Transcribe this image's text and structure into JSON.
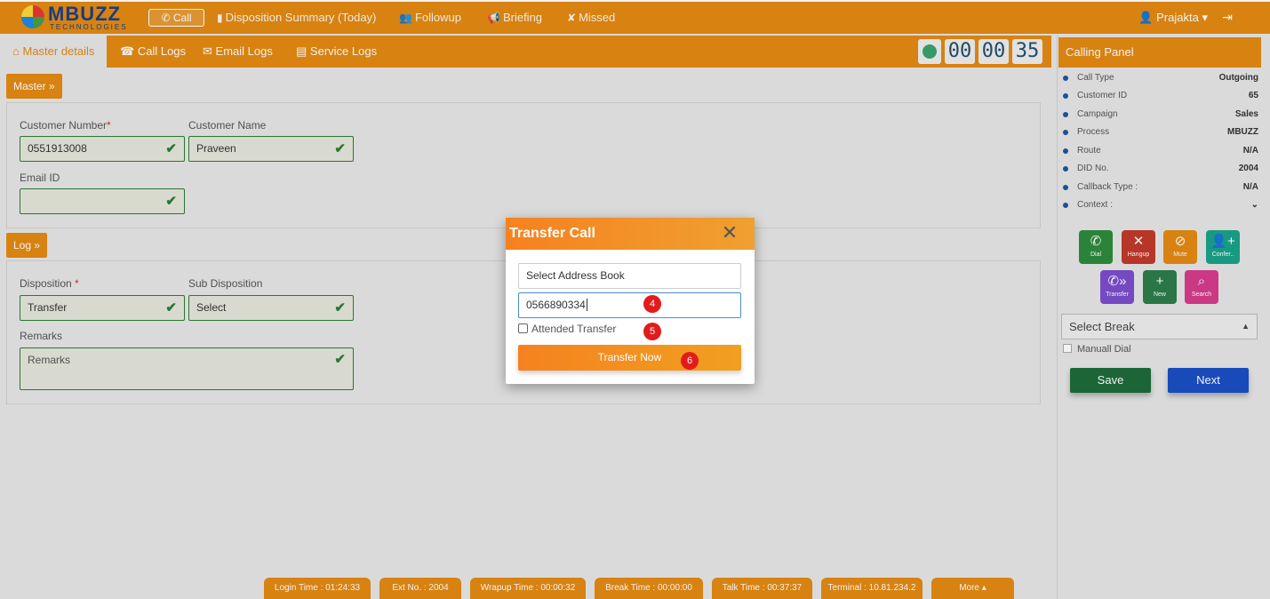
{
  "header": {
    "logo_main": "MBUZZ",
    "logo_sub": "TECHNOLOGIES",
    "call_label": "Call",
    "nav": [
      {
        "label": "Disposition Summary (Today)",
        "icon": "clipboard-icon"
      },
      {
        "label": "Followup",
        "icon": "users-icon"
      },
      {
        "label": "Briefing",
        "icon": "megaphone-icon"
      },
      {
        "label": "Missed",
        "icon": "missed-call-icon"
      }
    ],
    "user": "Prajakta"
  },
  "tabs": [
    {
      "label": "Master details",
      "icon": "home-icon"
    },
    {
      "label": "Call Logs",
      "icon": "phone-square-icon"
    },
    {
      "label": "Email Logs",
      "icon": "envelope-icon"
    },
    {
      "label": "Service Logs",
      "icon": "inbox-icon"
    }
  ],
  "timer": {
    "hh": "00",
    "mm": "00",
    "ss": "35"
  },
  "master": {
    "section": "Master",
    "customer_number_label": "Customer Number",
    "customer_number": "0551913008",
    "customer_name_label": "Customer Name",
    "customer_name": "Praveen",
    "email_label": "Email ID",
    "email": ""
  },
  "log": {
    "section": "Log",
    "disposition_label": "Disposition",
    "disposition": "Transfer",
    "sub_disposition_label": "Sub Disposition",
    "sub_disposition": "Select",
    "remarks_label": "Remarks",
    "remarks_placeholder": "Remarks"
  },
  "calling_panel": {
    "title": "Calling Panel",
    "rows": [
      {
        "key": "Call Type",
        "value": "Outgoing"
      },
      {
        "key": "Customer ID",
        "value": "65"
      },
      {
        "key": "Campaign",
        "value": "Sales"
      },
      {
        "key": "Process",
        "value": "MBUZZ"
      },
      {
        "key": "Route",
        "value": "N/A"
      },
      {
        "key": "DID No.",
        "value": "2004"
      },
      {
        "key": "Callback Type :",
        "value": "N/A"
      },
      {
        "key": "Context :",
        "value": ""
      }
    ],
    "controls": [
      {
        "label": "Dial",
        "color": "#2e8b3e"
      },
      {
        "label": "Hangup",
        "color": "#c0392b"
      },
      {
        "label": "Mute",
        "color": "#e38a12"
      },
      {
        "label": "Confer..",
        "color": "#1aa38a"
      },
      {
        "label": "Transfer",
        "color": "#7c4dcc"
      },
      {
        "label": "New",
        "color": "#2e7d4a"
      },
      {
        "label": "Search",
        "color": "#d63c8c"
      }
    ],
    "break_select": "Select Break",
    "manual_dial": "Manuall Dial",
    "save": "Save",
    "next": "Next"
  },
  "status_bar": [
    "Login Time : 01:24:33",
    "Ext No. : 2004",
    "Wrapup Time : 00:00:32",
    "Break Time : 00:00:00",
    "Talk Time : 00:37:37",
    "Terminal : 10.81.234.2",
    "More"
  ],
  "modal": {
    "title": "Transfer Call",
    "address_book": "Select Address Book",
    "number": "0566890334",
    "attended_label": "Attended Transfer",
    "transfer_button": "Transfer Now",
    "badges": [
      "4",
      "5",
      "6"
    ]
  },
  "colors": {
    "accent": "#e38a12",
    "success": "#2e7d32",
    "save": "#1e6b3a",
    "next": "#1a4fc4"
  }
}
